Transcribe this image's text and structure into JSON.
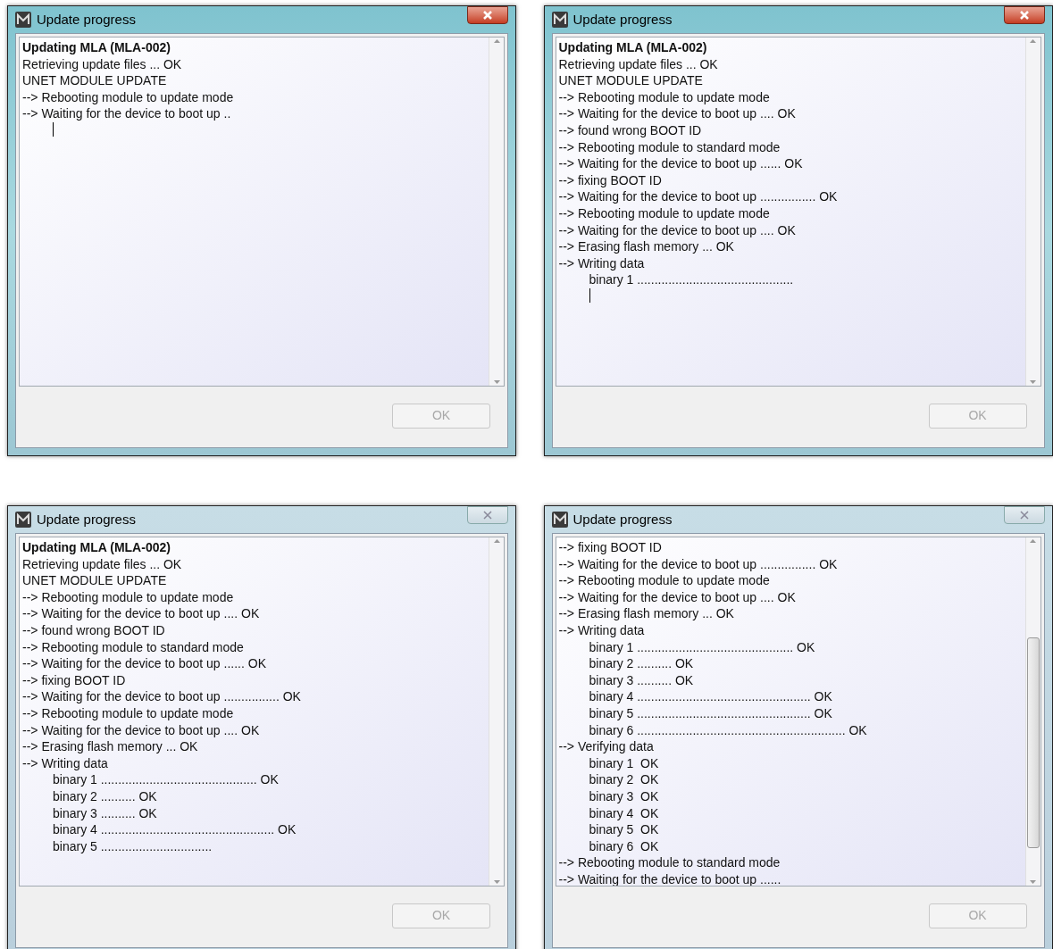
{
  "windows": [
    {
      "title": "Update progress",
      "active": true,
      "scroll_thumb": false,
      "ok_button": {
        "label": "OK",
        "disabled": true
      },
      "cursor": true,
      "lines": [
        {
          "text": "Updating MLA (MLA-002)",
          "bold": true
        },
        {
          "text": "Retrieving update files ... OK",
          "bold": false
        },
        {
          "text": "UNET MODULE UPDATE",
          "bold": false
        },
        {
          "text": "--> Rebooting module to update mode",
          "bold": false
        },
        {
          "text": "--> Waiting for the device to boot up ..",
          "bold": false
        }
      ]
    },
    {
      "title": "Update progress",
      "active": true,
      "scroll_thumb": false,
      "ok_button": {
        "label": "OK",
        "disabled": true
      },
      "cursor": true,
      "lines": [
        {
          "text": "Updating MLA (MLA-002)",
          "bold": true
        },
        {
          "text": "Retrieving update files ... OK",
          "bold": false
        },
        {
          "text": "UNET MODULE UPDATE",
          "bold": false
        },
        {
          "text": "--> Rebooting module to update mode",
          "bold": false
        },
        {
          "text": "--> Waiting for the device to boot up .... OK",
          "bold": false
        },
        {
          "text": "--> found wrong BOOT ID",
          "bold": false
        },
        {
          "text": "--> Rebooting module to standard mode",
          "bold": false
        },
        {
          "text": "--> Waiting for the device to boot up ...... OK",
          "bold": false
        },
        {
          "text": "--> fixing BOOT ID",
          "bold": false
        },
        {
          "text": "--> Waiting for the device to boot up ................ OK",
          "bold": false
        },
        {
          "text": "--> Rebooting module to update mode",
          "bold": false
        },
        {
          "text": "--> Waiting for the device to boot up .... OK",
          "bold": false
        },
        {
          "text": "--> Erasing flash memory ... OK",
          "bold": false
        },
        {
          "text": "--> Writing data",
          "bold": false,
          "children": [
            {
              "text": "binary 1 .............................................",
              "bold": false
            }
          ]
        }
      ]
    },
    {
      "title": "Update progress",
      "active": false,
      "scroll_thumb": false,
      "ok_button": {
        "label": "OK",
        "disabled": true
      },
      "cursor": false,
      "lines": [
        {
          "text": "Updating MLA (MLA-002)",
          "bold": true
        },
        {
          "text": "Retrieving update files ... OK",
          "bold": false
        },
        {
          "text": "UNET MODULE UPDATE",
          "bold": false
        },
        {
          "text": "--> Rebooting module to update mode",
          "bold": false
        },
        {
          "text": "--> Waiting for the device to boot up .... OK",
          "bold": false
        },
        {
          "text": "--> found wrong BOOT ID",
          "bold": false
        },
        {
          "text": "--> Rebooting module to standard mode",
          "bold": false
        },
        {
          "text": "--> Waiting for the device to boot up ...... OK",
          "bold": false
        },
        {
          "text": "--> fixing BOOT ID",
          "bold": false
        },
        {
          "text": "--> Waiting for the device to boot up ................ OK",
          "bold": false
        },
        {
          "text": "--> Rebooting module to update mode",
          "bold": false
        },
        {
          "text": "--> Waiting for the device to boot up .... OK",
          "bold": false
        },
        {
          "text": "--> Erasing flash memory ... OK",
          "bold": false
        },
        {
          "text": "--> Writing data",
          "bold": false,
          "children": [
            {
              "text": "binary 1 ............................................. OK",
              "bold": false
            },
            {
              "text": "binary 2 .......... OK",
              "bold": false
            },
            {
              "text": "binary 3 .......... OK",
              "bold": false
            },
            {
              "text": "binary 4 .................................................. OK",
              "bold": false
            },
            {
              "text": "binary 5 ................................",
              "bold": false
            }
          ]
        }
      ]
    },
    {
      "title": "Update progress",
      "active": false,
      "scroll_thumb": true,
      "ok_button": {
        "label": "OK",
        "disabled": true
      },
      "cursor": false,
      "lines": [
        {
          "text": "--> fixing BOOT ID",
          "bold": false
        },
        {
          "text": "--> Waiting for the device to boot up ................ OK",
          "bold": false
        },
        {
          "text": "--> Rebooting module to update mode",
          "bold": false
        },
        {
          "text": "--> Waiting for the device to boot up .... OK",
          "bold": false
        },
        {
          "text": "--> Erasing flash memory ... OK",
          "bold": false
        },
        {
          "text": "--> Writing data",
          "bold": false,
          "children": [
            {
              "text": "binary 1 ............................................. OK",
              "bold": false
            },
            {
              "text": "binary 2 .......... OK",
              "bold": false
            },
            {
              "text": "binary 3 .......... OK",
              "bold": false
            },
            {
              "text": "binary 4 .................................................. OK",
              "bold": false
            },
            {
              "text": "binary 5 .................................................. OK",
              "bold": false
            },
            {
              "text": "binary 6 ............................................................ OK",
              "bold": false
            }
          ]
        },
        {
          "text": "--> Verifying data",
          "bold": false,
          "children": [
            {
              "text": "binary 1  OK",
              "bold": false
            },
            {
              "text": "binary 2  OK",
              "bold": false
            },
            {
              "text": "binary 3  OK",
              "bold": false
            },
            {
              "text": "binary 4  OK",
              "bold": false
            },
            {
              "text": "binary 5  OK",
              "bold": false
            },
            {
              "text": "binary 6  OK",
              "bold": false
            }
          ]
        },
        {
          "text": "--> Rebooting module to standard mode",
          "bold": false
        },
        {
          "text": "--> Waiting for the device to boot up ......",
          "bold": false
        }
      ]
    }
  ]
}
